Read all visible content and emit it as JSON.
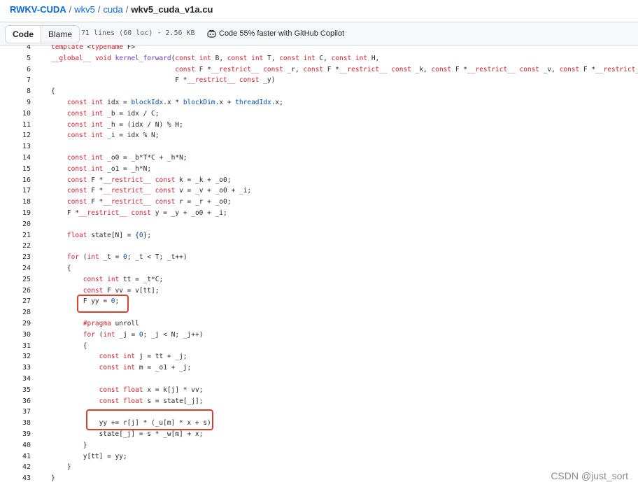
{
  "breadcrumb": {
    "repo": "RWKV-CUDA",
    "folders": [
      "wkv5",
      "cuda"
    ],
    "file": "wkv5_cuda_v1a.cu"
  },
  "toolbar": {
    "tab_code": "Code",
    "tab_blame": "Blame",
    "meta": "71 lines (60 loc) · 2.56 KB",
    "copilot": "Code 55% faster with GitHub Copilot"
  },
  "code_lines": [
    {
      "n": "4",
      "t": "template <typename F>"
    },
    {
      "n": "5",
      "t": "__global__ void kernel_forward(const int B, const int T, const int C, const int H,"
    },
    {
      "n": "6",
      "t": "                               const F *__restrict__ const _r, const F *__restrict__ const _k, const F *__restrict__ const _v, const F *__restrict__"
    },
    {
      "n": "7",
      "t": "                               F *__restrict__ const _y)"
    },
    {
      "n": "8",
      "t": "{"
    },
    {
      "n": "9",
      "t": "    const int idx = blockIdx.x * blockDim.x + threadIdx.x;"
    },
    {
      "n": "10",
      "t": "    const int _b = idx / C;"
    },
    {
      "n": "11",
      "t": "    const int _h = (idx / N) % H;"
    },
    {
      "n": "12",
      "t": "    const int _i = idx % N;"
    },
    {
      "n": "13",
      "t": ""
    },
    {
      "n": "14",
      "t": "    const int _o0 = _b*T*C + _h*N;"
    },
    {
      "n": "15",
      "t": "    const int _o1 = _h*N;"
    },
    {
      "n": "16",
      "t": "    const F *__restrict__ const k = _k + _o0;"
    },
    {
      "n": "17",
      "t": "    const F *__restrict__ const v = _v + _o0 + _i;"
    },
    {
      "n": "18",
      "t": "    const F *__restrict__ const r = _r + _o0;"
    },
    {
      "n": "19",
      "t": "    F *__restrict__ const y = _y + _o0 + _i;"
    },
    {
      "n": "20",
      "t": ""
    },
    {
      "n": "21",
      "t": "    float state[N] = {0};"
    },
    {
      "n": "22",
      "t": ""
    },
    {
      "n": "23",
      "t": "    for (int _t = 0; _t < T; _t++)"
    },
    {
      "n": "24",
      "t": "    {"
    },
    {
      "n": "25",
      "t": "        const int tt = _t*C;"
    },
    {
      "n": "26",
      "t": "        const F vv = v[tt];"
    },
    {
      "n": "27",
      "t": "        F yy = 0;"
    },
    {
      "n": "28",
      "t": ""
    },
    {
      "n": "29",
      "t": "        #pragma unroll"
    },
    {
      "n": "30",
      "t": "        for (int _j = 0; _j < N; _j++)"
    },
    {
      "n": "31",
      "t": "        {"
    },
    {
      "n": "32",
      "t": "            const int j = tt + _j;"
    },
    {
      "n": "33",
      "t": "            const int m = _o1 + _j;"
    },
    {
      "n": "34",
      "t": ""
    },
    {
      "n": "35",
      "t": "            const float x = k[j] * vv;"
    },
    {
      "n": "36",
      "t": "            const float s = state[_j];"
    },
    {
      "n": "37",
      "t": ""
    },
    {
      "n": "38",
      "t": "            yy += r[j] * (_u[m] * x + s)"
    },
    {
      "n": "39",
      "t": "            state[_j] = s * _w[m] + x;"
    },
    {
      "n": "40",
      "t": "        }"
    },
    {
      "n": "41",
      "t": "        y[tt] = yy;"
    },
    {
      "n": "42",
      "t": "    }"
    },
    {
      "n": "43",
      "t": "}"
    }
  ],
  "watermark": "CSDN @just_sort",
  "colors": {
    "keyword": "#cf222e",
    "function": "#6639ba",
    "builtin": "#0550ae",
    "highlight_box": "#d9412e"
  }
}
